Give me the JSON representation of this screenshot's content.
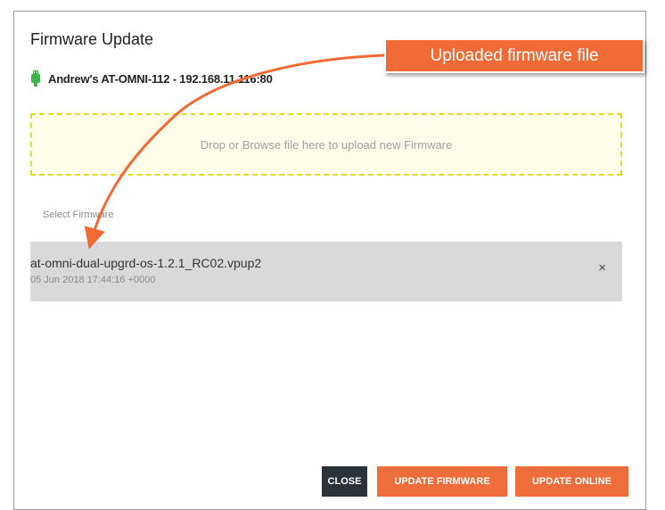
{
  "dialog": {
    "title": "Firmware Update",
    "device": {
      "icon": "usb-plug-icon",
      "label": "Andrew's AT-OMNI-112 - 192.168.11.116:80"
    },
    "dropzone_text": "Drop or Browse file here to upload new Firmware",
    "select_label": "Select Firmware",
    "file": {
      "name": "at-omni-dual-upgrd-os-1.2.1_RC02.vpup2",
      "date": "05 Jun 2018 17:44:16 +0000",
      "remove_icon": "×"
    },
    "buttons": {
      "close": "CLOSE",
      "update_firmware": "UPDATE FIRMWARE",
      "update_online": "UPDATE ONLINE"
    }
  },
  "annotation": {
    "callout_text": "Uploaded firmware file"
  },
  "colors": {
    "accent": "#ef6c3b",
    "dark_button": "#2a3338",
    "device_icon": "#3fb24a",
    "dropzone_border": "#e3db2c",
    "file_row_bg": "#d9d9d9"
  }
}
